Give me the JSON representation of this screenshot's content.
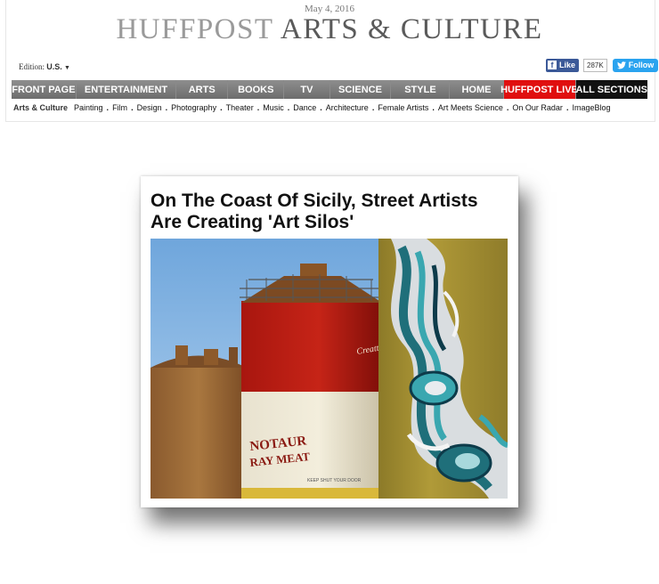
{
  "header": {
    "date": "May 4, 2016",
    "brand": "HUFFPOST",
    "section": "ARTS & CULTURE",
    "edition_label": "Edition:",
    "edition_value": "U.S."
  },
  "social": {
    "fb_like": "Like",
    "fb_count": "287K",
    "twitter_follow": "Follow"
  },
  "nav": {
    "items": [
      "FRONT PAGE",
      "ENTERTAINMENT",
      "ARTS",
      "BOOKS",
      "TV",
      "SCIENCE",
      "STYLE",
      "HOME",
      "HUFFPOST LIVE",
      "ALL SECTIONS"
    ]
  },
  "subnav": {
    "home": "Arts & Culture",
    "items": [
      "Painting",
      "Film",
      "Design",
      "Photography",
      "Theater",
      "Music",
      "Dance",
      "Architecture",
      "Female Artists",
      "Art Meets Science",
      "On Our Radar",
      "ImageBlog"
    ]
  },
  "article": {
    "headline_line1": "On The Coast Of Sicily, Street Artists",
    "headline_line2": "Are Creating 'Art Silos'",
    "silo_text_1": "NOTAUR",
    "silo_text_2": "RAY MEAT",
    "silo_script": "Creattive Sicilia",
    "silo_band_text": "KEEP SHUT YOUR DOOR"
  },
  "colors": {
    "nav_bg": "#7d7d7d",
    "live_red": "#e00f0f",
    "all_black": "#111111",
    "fb_blue": "#3b5998",
    "twitter_blue": "#2aa3ef"
  }
}
